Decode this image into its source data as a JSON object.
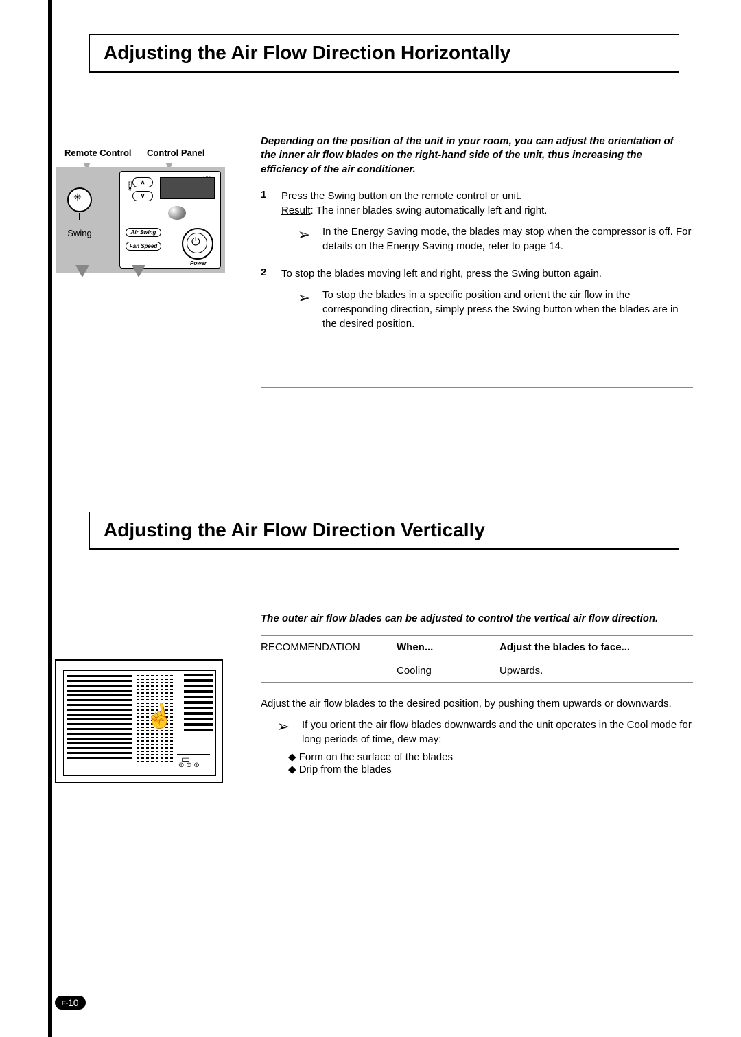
{
  "section1": {
    "title": "Adjusting the Air Flow Direction Horizontally",
    "labels": {
      "remote_control": "Remote Control",
      "control_panel": "Control Panel",
      "swing": "Swing",
      "air_swing": "Air Swing",
      "fan_speed": "Fan Speed",
      "power": "Power"
    },
    "intro": "Depending on the position of the unit in your room, you can adjust the orientation of the inner air flow blades on the right-hand side of the unit, thus increasing the efficiency of the air conditioner.",
    "step1_num": "1",
    "step1_text": "Press the Swing button on the remote control or unit.",
    "step1_result_label": "Result",
    "step1_result_text": ":   The inner blades swing automatically left and right.",
    "note1": "In the Energy Saving mode, the blades may stop when the compressor is off. For details on the Energy Saving mode, refer to page 14.",
    "step2_num": "2",
    "step2_text": "To stop the blades moving left and right, press the Swing button again.",
    "note2": "To stop the blades in a specific position and orient the air flow in the corresponding direction, simply press the Swing button when the blades are in the desired position."
  },
  "section2": {
    "title": "Adjusting the Air Flow Direction Vertically",
    "intro": "The outer air flow blades can be adjusted to control the vertical air flow direction.",
    "rec_label": "RECOMMENDATION",
    "col_when": "When...",
    "col_adjust": "Adjust the blades to face...",
    "row_when": "Cooling",
    "row_adjust": "Upwards.",
    "adjust_line": "Adjust the air flow blades to the desired position, by pushing them upwards or downwards.",
    "warn": "If you orient the air flow blades downwards and the unit operates in the Cool mode for long periods of time, dew may:",
    "bullet1": "Form on the surface of the blades",
    "bullet2": "Drip from the blades"
  },
  "page_number_prefix": "E-",
  "page_number": "10"
}
